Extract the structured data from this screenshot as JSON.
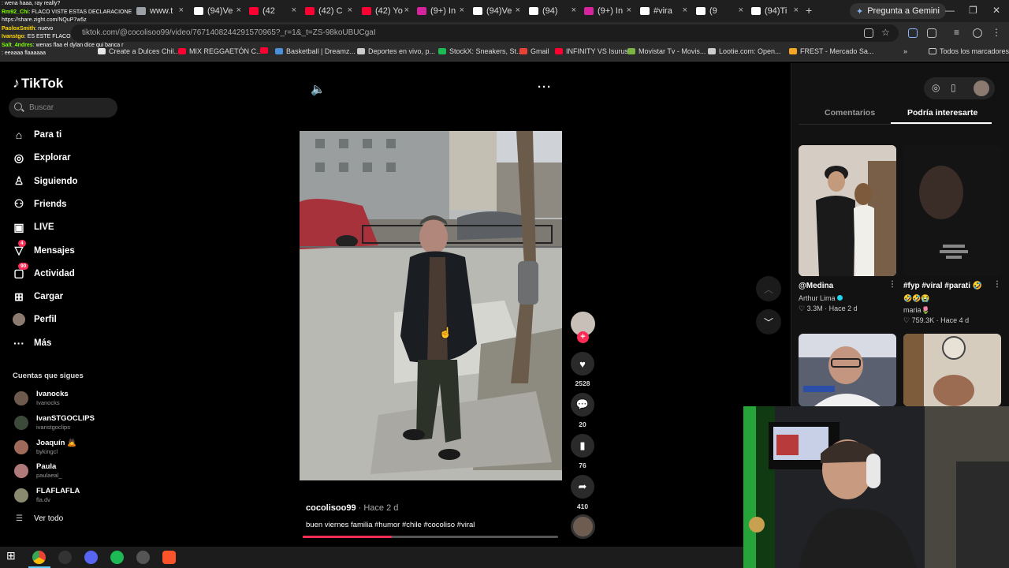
{
  "browser": {
    "tabs": [
      {
        "label": "www.t",
        "color": "#9aa0a6"
      },
      {
        "label": "(94)Ve",
        "color": "#ffffff"
      },
      {
        "label": "(42",
        "color": "#ff0033"
      },
      {
        "label": "(42) C",
        "color": "#ff0033"
      },
      {
        "label": "(42) Yo",
        "color": "#ff0033"
      },
      {
        "label": "(9+) In",
        "color": "#d6249f"
      },
      {
        "label": "(94)Ve",
        "color": "#ffffff"
      },
      {
        "label": "(94)",
        "color": "#ffffff"
      },
      {
        "label": "(9+) In",
        "color": "#d6249f"
      },
      {
        "label": "#vira",
        "color": "#ffffff"
      },
      {
        "label": "(9",
        "color": "#ffffff"
      },
      {
        "label": "(94)Ti",
        "color": "#ffffff"
      }
    ],
    "new_tab": "+",
    "gemini_label": "Pregunta a Gemini",
    "url": "tiktok.com/@cocolisoo99/video/7671408244291570965?_r=1&_t=ZS-98koUBUCgaI",
    "bookmarks": [
      {
        "label": "Create a Dulces Chil...",
        "color": "#e6e6e6"
      },
      {
        "label": "MIX REGGAETÓN C...",
        "color": "#ff0033"
      },
      {
        "label": "",
        "color": "#ff0033"
      },
      {
        "label": "Basketball | Dreamz...",
        "color": "#4a90d9"
      },
      {
        "label": "Deportes en vivo, p...",
        "color": "#cccccc"
      },
      {
        "label": "StockX: Sneakers, St...",
        "color": "#1db954"
      },
      {
        "label": "Gmail",
        "color": "#ea4335"
      },
      {
        "label": "INFINITY VS Isurus",
        "color": "#ff0033"
      },
      {
        "label": "Movistar Tv - Movis...",
        "color": "#7cb342"
      },
      {
        "label": "Lootie.com: Open...",
        "color": "#cccccc"
      },
      {
        "label": "FREST - Mercado Sa...",
        "color": "#f5a623"
      }
    ],
    "bookmarks_overflow": "»",
    "all_bookmarks": "Todos los marcadores"
  },
  "chat": [
    {
      "user": "",
      "msg": ": wena haaa, ray really?",
      "color": "#ff4d4d"
    },
    {
      "user": "Rm92_Chi",
      "msg": ": FLACO VISTE ESTAS DECLARACIONES",
      "color": "#7CFC00"
    },
    {
      "user": "",
      "msg": "https://share.zight.com/NQuP7w5z",
      "color": "#ffffff"
    },
    {
      "user": "PaoloxSmith",
      "msg": ": nuevo",
      "color": "#ffd700"
    },
    {
      "user": "Ivanstgo",
      "msg": ": ES  ESTE FLACO",
      "color": "#ffd700"
    },
    {
      "user": "Salt_4ndres",
      "msg": ": wenas flaa el dylan dice qui banca r",
      "color": "#7CFC00"
    },
    {
      "user": "",
      "msg": ": eeaaaa flaaaaaa",
      "color": "#ff4d4d"
    }
  ],
  "tiktok": {
    "logo": "TikTok",
    "search_placeholder": "Buscar",
    "nav": [
      {
        "label": "Para ti",
        "icon": "home-icon",
        "glyph": "⌂",
        "badge": ""
      },
      {
        "label": "Explorar",
        "icon": "compass-icon",
        "glyph": "◎",
        "badge": ""
      },
      {
        "label": "Siguiendo",
        "icon": "following-icon",
        "glyph": "♙",
        "badge": ""
      },
      {
        "label": "Friends",
        "icon": "friends-icon",
        "glyph": "⚇",
        "badge": ""
      },
      {
        "label": "LIVE",
        "icon": "live-icon",
        "glyph": "▣",
        "badge": ""
      },
      {
        "label": "Mensajes",
        "icon": "messages-icon",
        "glyph": "▽",
        "badge": "4"
      },
      {
        "label": "Actividad",
        "icon": "activity-icon",
        "glyph": "▢",
        "badge": "90"
      },
      {
        "label": "Cargar",
        "icon": "upload-icon",
        "glyph": "⊞",
        "badge": ""
      },
      {
        "label": "Perfil",
        "icon": "profile-avatar",
        "glyph": "",
        "badge": ""
      },
      {
        "label": "Más",
        "icon": "more-icon",
        "glyph": "···",
        "badge": ""
      }
    ],
    "following_header": "Cuentas que sigues",
    "following": [
      {
        "name": "Ivanocks",
        "handle": "Ivanocks",
        "color": "#6d5a4c"
      },
      {
        "name": "IvanSTGOCLIPS",
        "handle": "ivanstgoclips",
        "color": "#3c4a3a"
      },
      {
        "name": "Joaquín 🙇",
        "handle": "bykingcl",
        "color": "#a06a5a"
      },
      {
        "name": "Paula",
        "handle": "paulaeal_",
        "color": "#b07a7a"
      },
      {
        "name": "FLAFLAFLA",
        "handle": "fla.dv",
        "color": "#8a8a70"
      }
    ],
    "see_all": "Ver todo",
    "video": {
      "author": "cocolisoo99",
      "time": " · Hace 2 d",
      "caption": "buen viernes familia #humor #chile #cocoliso #viral",
      "progress": 0.35
    },
    "actions": {
      "likes": "2528",
      "comments": "20",
      "saves": "76",
      "shares": "410"
    },
    "tabs": {
      "comments": "Comentarios",
      "recommended": "Podría interesarte"
    },
    "recommended": [
      {
        "title": "@Medina",
        "author": "Arthur Lima",
        "verified": true,
        "likes": "3.3M",
        "age": "Hace 2 d",
        "emojis": ""
      },
      {
        "title": "#fyp #viral #parati 🤣",
        "author": "maria🌷",
        "verified": false,
        "likes": "759.3K",
        "age": "Hace 4 d",
        "emojis": "🤣🤣😭"
      }
    ]
  },
  "colors": {
    "accent": "#fe2c55",
    "bg": "#000000",
    "panel": "#121212"
  }
}
